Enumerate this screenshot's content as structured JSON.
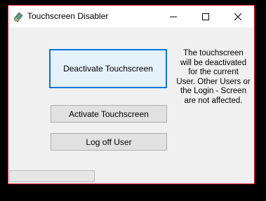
{
  "window": {
    "title": "Touchscreen Disabler",
    "app_icon": "touchscreen-app-icon",
    "controls": {
      "minimize_icon": "minimize-icon",
      "maximize_icon": "maximize-icon",
      "close_icon": "close-icon"
    }
  },
  "buttons": {
    "deactivate_label": "Deactivate Touchscreen",
    "activate_label": "Activate Touchscreen",
    "logoff_label": "Log off User"
  },
  "info": {
    "lines": [
      "The touchscreen",
      "will be deactivated",
      "for the current",
      "User. Other Users or",
      "the Login - Screen",
      "are not affected."
    ]
  },
  "colors": {
    "focus_border": "#0078d7",
    "window_border": "#e81123",
    "background": "#f0f0f0"
  }
}
